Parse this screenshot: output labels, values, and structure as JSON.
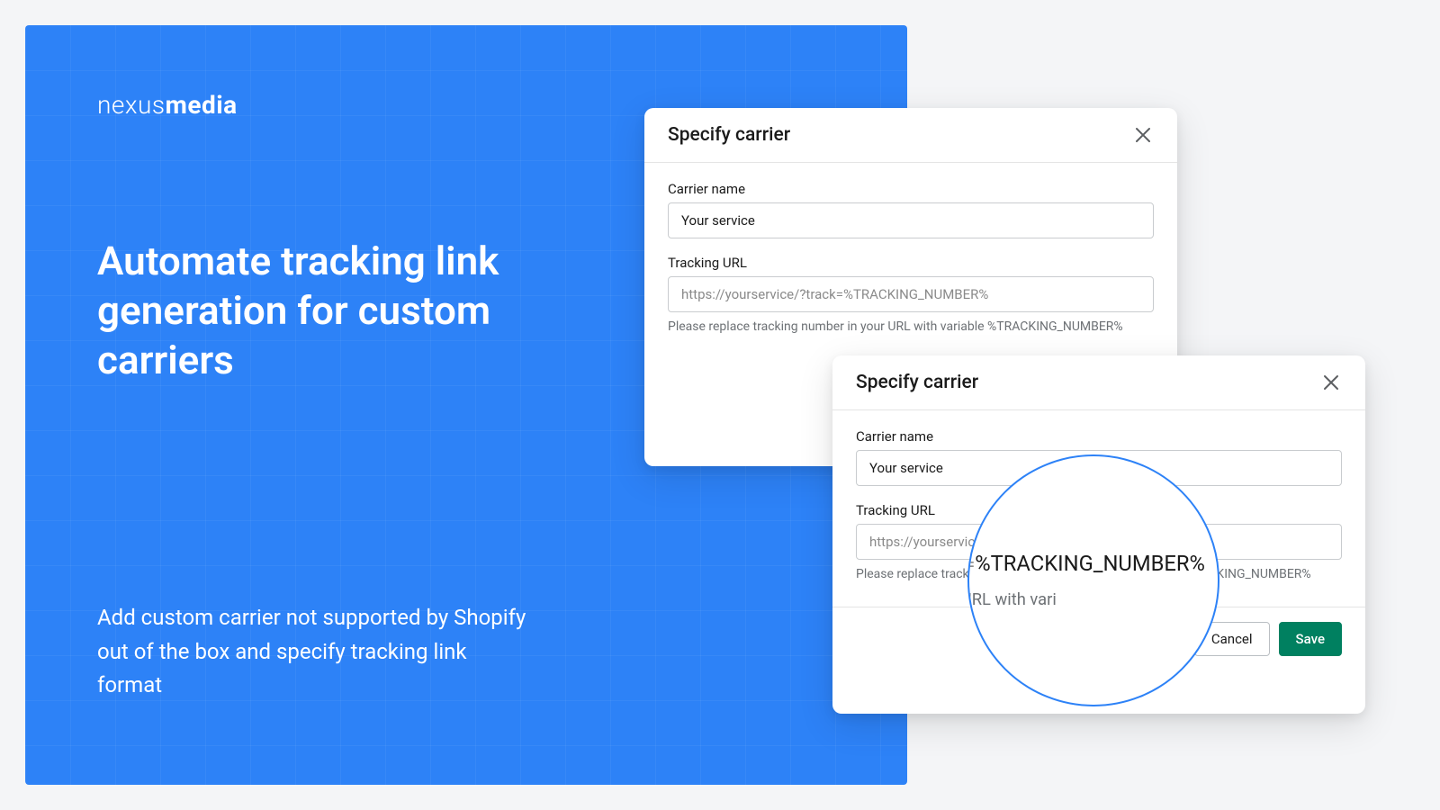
{
  "brand": {
    "light": "nexus",
    "bold": "media"
  },
  "headline": "Automate tracking link generation for custom carriers",
  "subtext": "Add custom carrier not supported by Shopify out of the box and specify tracking link format",
  "modal": {
    "title": "Specify carrier",
    "carrier_label": "Carrier name",
    "carrier_value": "Your service",
    "tracking_label": "Tracking URL",
    "tracking_placeholder": "https://yourservice/?track=%TRACKING_NUMBER%",
    "help_text": "Please replace tracking number in your URL with variable %TRACKING_NUMBER%",
    "cancel": "Cancel",
    "save": "Save"
  },
  "magnifier": {
    "prefix": "https://yourservice/?track=",
    "variable": "%TRACKING_NUMBER%",
    "help_fragment": "er in your URL with vari"
  }
}
